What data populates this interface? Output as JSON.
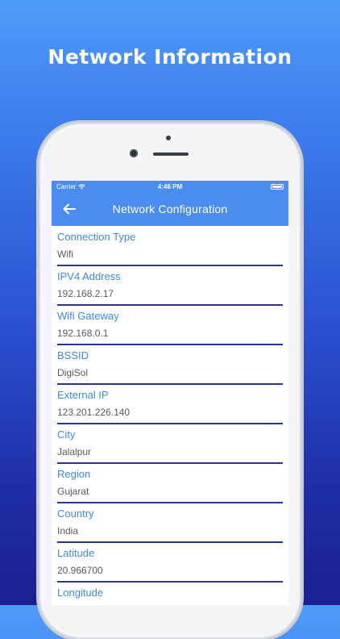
{
  "promo": {
    "title": "Network Information"
  },
  "status_bar": {
    "carrier": "Carrier",
    "time": "4:46 PM"
  },
  "app_bar": {
    "title": "Network Configuration",
    "back_icon": "arrow-left-icon"
  },
  "fields": [
    {
      "label": "Connection Type",
      "value": "Wifi"
    },
    {
      "label": "IPV4 Address",
      "value": "192.168.2.17"
    },
    {
      "label": "Wifi Gateway",
      "value": "192.168.0.1"
    },
    {
      "label": "BSSID",
      "value": "DigiSol"
    },
    {
      "label": "External IP",
      "value": "123.201.226.140"
    },
    {
      "label": "City",
      "value": "Jalalpur"
    },
    {
      "label": "Region",
      "value": "Gujarat"
    },
    {
      "label": "Country",
      "value": "India"
    },
    {
      "label": "Latitude",
      "value": "20.966700"
    },
    {
      "label": "Longitude",
      "value": ""
    }
  ],
  "colors": {
    "accent": "#4a8cf0",
    "label": "#3d87e3",
    "divider": "#283593",
    "background_top": "#4f9bfb",
    "background_bottom": "#1a208f"
  }
}
